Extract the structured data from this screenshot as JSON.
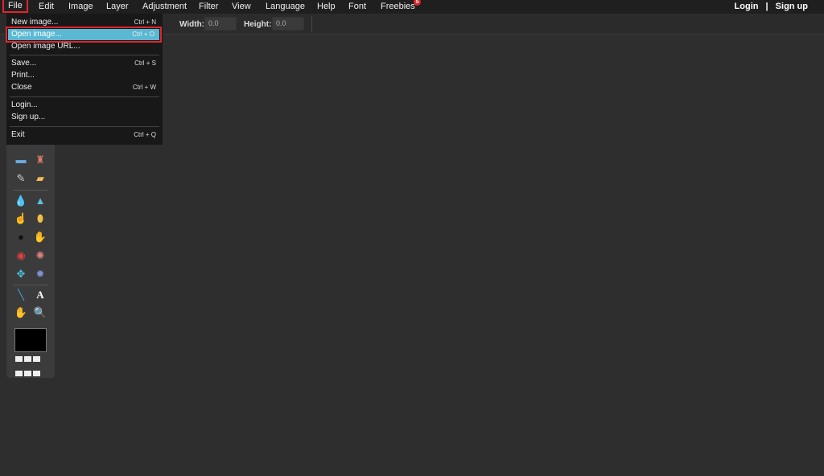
{
  "menubar": {
    "items": [
      "File",
      "Edit",
      "Image",
      "Layer",
      "Adjustment",
      "Filter",
      "View",
      "Language",
      "Help",
      "Font",
      "Freebies"
    ],
    "freebies_badge": "5",
    "login": "Login",
    "separator": "|",
    "signup": "Sign up"
  },
  "options": {
    "width_label": "Width:",
    "width_value": "0.0",
    "height_label": "Height:",
    "height_value": "0.0"
  },
  "file_menu": {
    "items": [
      {
        "label": "New image...",
        "shortcut": "Ctrl + N"
      },
      {
        "label": "Open image...",
        "shortcut": "Ctrl + O"
      },
      {
        "label": "Open image URL...",
        "shortcut": ""
      },
      {
        "label": "Save...",
        "shortcut": "Ctrl + S"
      },
      {
        "label": "Print...",
        "shortcut": ""
      },
      {
        "label": "Close",
        "shortcut": "Ctrl + W"
      },
      {
        "label": "Login...",
        "shortcut": ""
      },
      {
        "label": "Sign up...",
        "shortcut": ""
      },
      {
        "label": "Exit",
        "shortcut": "Ctrl + Q"
      }
    ]
  },
  "tools": [
    "gradient-icon",
    "stamp-icon",
    "healing-icon",
    "replace-color-icon",
    "blur-icon",
    "sharpen-icon",
    "smudge-icon",
    "sponge-icon",
    "dodge-icon",
    "burn-icon",
    "red-eye-icon",
    "bloat-icon",
    "pinch-icon",
    "spherize-icon",
    "color-picker-icon",
    "text-icon",
    "hand-icon",
    "zoom-icon"
  ],
  "colors": {
    "highlight": "#5ab8d3",
    "annotation": "#e0252b",
    "background": "#2e2e2e",
    "menubar": "#1f1f1f"
  }
}
